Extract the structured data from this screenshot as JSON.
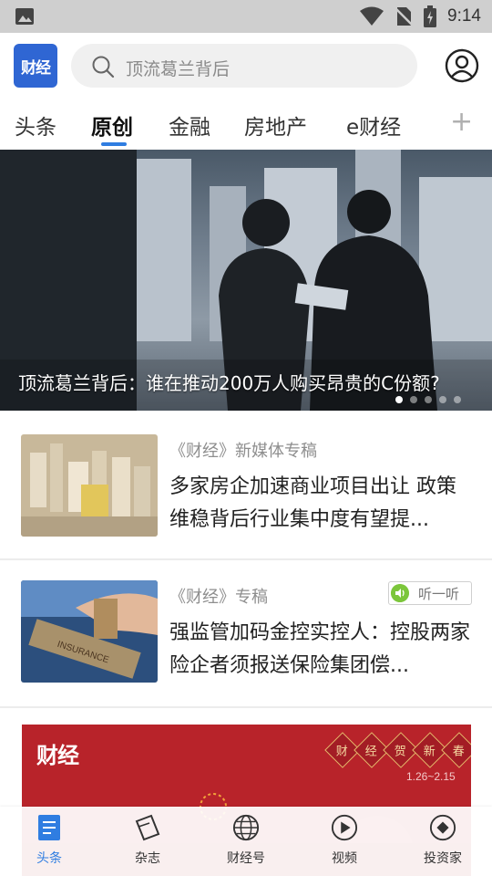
{
  "status_bar": {
    "time": "9:14",
    "icons": [
      "image-icon",
      "wifi-icon",
      "no-sim-icon",
      "battery-icon"
    ]
  },
  "header": {
    "logo_text": "财经",
    "search_placeholder": "顶流葛兰背后"
  },
  "tabs": [
    {
      "label": "头条",
      "active": false
    },
    {
      "label": "原创",
      "active": true
    },
    {
      "label": "金融",
      "active": false
    },
    {
      "label": "房地产",
      "active": false
    },
    {
      "label": "e财经",
      "active": false
    }
  ],
  "tab_add_label": "+",
  "hero": {
    "caption": "顶流葛兰背后：谁在推动200万人购买昂贵的C份额?",
    "dots_total": 5,
    "dots_active": 1
  },
  "articles": [
    {
      "source": "《财经》新媒体专稿",
      "title": "多家房企加速商业项目出让 政策维稳背后行业集中度有望提..."
    },
    {
      "source": "《财经》专稿",
      "title": "强监管加码金控实控人：控股两家险企者须报送保险集团偿...",
      "listen_label": "听一听"
    }
  ],
  "banner": {
    "logo": "财经",
    "greeting": [
      "财",
      "经",
      "贺",
      "新",
      "春"
    ],
    "dates": "1.26~2.15"
  },
  "bottom_nav": [
    {
      "label": "头条",
      "icon": "document-icon",
      "active": true
    },
    {
      "label": "杂志",
      "icon": "magazine-icon",
      "active": false
    },
    {
      "label": "财经号",
      "icon": "globe-icon",
      "active": false
    },
    {
      "label": "视频",
      "icon": "play-icon",
      "active": false
    },
    {
      "label": "投资家",
      "icon": "diamond-icon",
      "active": false
    }
  ],
  "colors": {
    "accent": "#2f7de1",
    "logo_blue": "#2f66d3",
    "banner_red": "#b8232a",
    "listen_green": "#7cc63b"
  }
}
